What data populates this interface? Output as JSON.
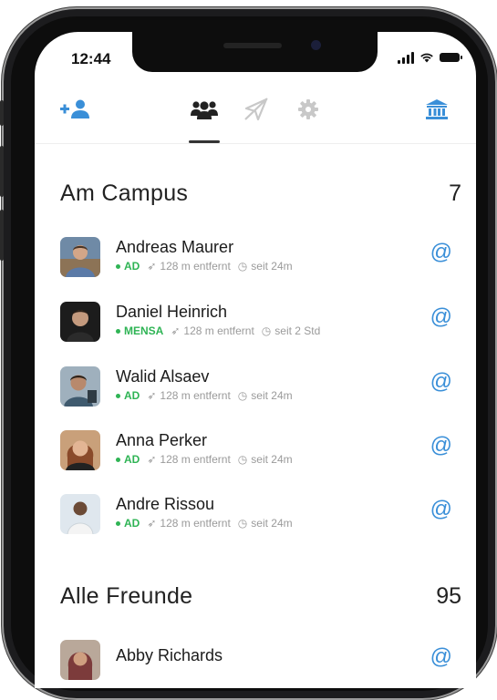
{
  "status_bar": {
    "time": "12:44"
  },
  "nav": {
    "icons": [
      "add-friend-icon",
      "friends-icon",
      "location-off-icon",
      "settings-icon",
      "university-icon"
    ],
    "accent_color": "#3a8fd8"
  },
  "sections": [
    {
      "title": "Am Campus",
      "count": "7",
      "contacts": [
        {
          "name": "Andreas Maurer",
          "location": "AD",
          "distance": "128 m entfernt",
          "since": "seit 24m",
          "action": "@"
        },
        {
          "name": "Daniel Heinrich",
          "location": "MENSA",
          "distance": "128 m entfernt",
          "since": "seit 2 Std",
          "action": "@"
        },
        {
          "name": "Walid Alsaev",
          "location": "AD",
          "distance": "128 m entfernt",
          "since": "seit 24m",
          "action": "@"
        },
        {
          "name": "Anna Perker",
          "location": "AD",
          "distance": "128 m entfernt",
          "since": "seit 24m",
          "action": "@"
        },
        {
          "name": "Andre Rissou",
          "location": "AD",
          "distance": "128 m entfernt",
          "since": "seit 24m",
          "action": "@"
        }
      ]
    },
    {
      "title": "Alle Freunde",
      "count": "95",
      "contacts": [
        {
          "name": "Abby Richards",
          "action": "@"
        }
      ]
    }
  ],
  "colors": {
    "location_green": "#2fb455",
    "action_blue": "#3a8fd8"
  }
}
